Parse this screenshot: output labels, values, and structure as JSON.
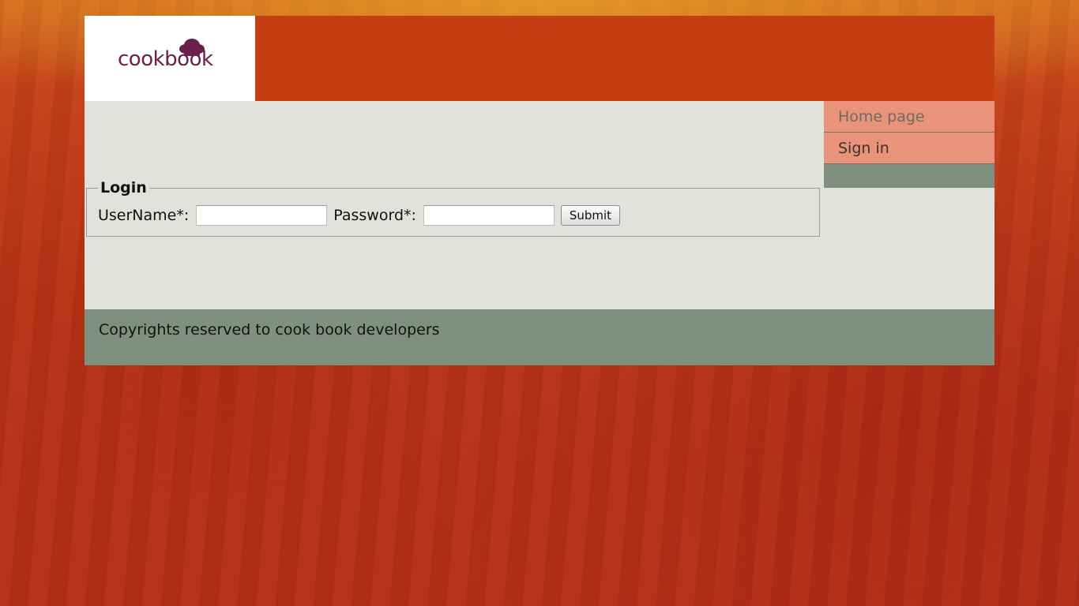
{
  "header": {
    "logo_text": "cookbook",
    "logo_color": "#6b1f4d",
    "bar_color": "#c63f12"
  },
  "nav": {
    "items": [
      {
        "label": "Home page"
      },
      {
        "label": "Sign in"
      }
    ]
  },
  "login": {
    "legend": "Login",
    "username_label": "UserName*:",
    "username_value": "",
    "password_label": "Password*:",
    "password_value": "",
    "submit_label": "Submit"
  },
  "footer": {
    "text": "Copyrights reserved to cook book developers"
  }
}
